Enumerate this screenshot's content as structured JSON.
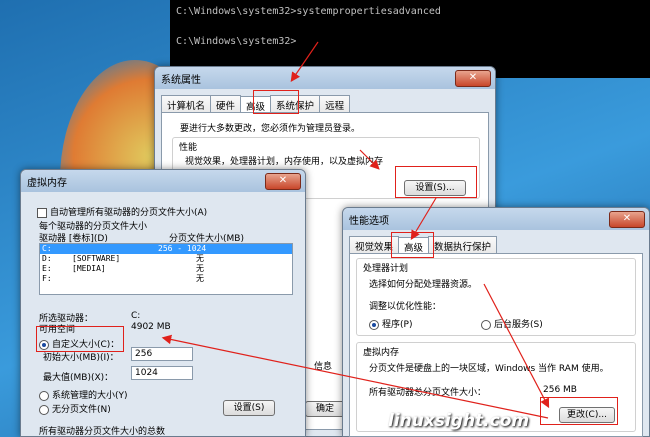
{
  "cmd": {
    "line1": "C:\\Windows\\system32>systempropertiesadvanced",
    "line2": "C:\\Windows\\system32>"
  },
  "sysprops": {
    "title": "系统属性",
    "close": "✕",
    "tabs": [
      "计算机名",
      "硬件",
      "高级",
      "系统保护",
      "远程"
    ],
    "admin_note": "要进行大多数更改，您必须作为管理员登录。",
    "perf_group": "性能",
    "perf_desc": "视觉效果，处理器计划，内存使用，以及虚拟内存",
    "settings_button": "设置(S)...",
    "ok_partial": "确定",
    "info_partial": "信息"
  },
  "perfopts": {
    "title": "性能选项",
    "close": "✕",
    "tabs": [
      "视觉效果",
      "高级",
      "数据执行保护"
    ],
    "cpu_group": "处理器计划",
    "cpu_desc": "选择如何分配处理器资源。",
    "adjust_label": "调整以优化性能：",
    "radio_programs": "程序(P)",
    "radio_services": "后台服务(S)",
    "vm_group": "虚拟内存",
    "vm_desc": "分页文件是硬盘上的一块区域，Windows 当作 RAM 使用。",
    "vm_total_label": "所有驱动器总分页文件大小：",
    "vm_total_value": "256 MB",
    "change_button": "更改(C)..."
  },
  "vmem": {
    "title": "虚拟内存",
    "close": "✕",
    "auto_manage": "自动管理所有驱动器的分页文件大小(A)",
    "per_drive": "每个驱动器的分页文件大小",
    "col_drive": "驱动器 [卷标](D)",
    "col_size": "分页文件大小(MB)",
    "drives": [
      {
        "drive": "C:",
        "label": "",
        "size": "256 - 1024"
      },
      {
        "drive": "D:",
        "label": "[SOFTWARE]",
        "size": "无"
      },
      {
        "drive": "E:",
        "label": "[MEDIA]",
        "size": "无"
      },
      {
        "drive": "F:",
        "label": "",
        "size": "无"
      }
    ],
    "selected_drive_label": "所选驱动器：",
    "selected_drive_value": "C:",
    "free_space_label": "可用空间",
    "free_space_value": "4902 MB",
    "radio_custom": "自定义大小(C)：",
    "initial_label": "初始大小(MB)(I)：",
    "initial_value": "256",
    "max_label": "最大值(MB)(X)：",
    "max_value": "1024",
    "radio_system": "系统管理的大小(Y)",
    "radio_none": "无分页文件(N)",
    "set_button": "设置(S)",
    "total_label": "所有驱动器分页文件大小的总数"
  },
  "watermark": "linuxsight.com",
  "colors": {
    "accent": "#e0211b",
    "selection": "#3399ff"
  }
}
